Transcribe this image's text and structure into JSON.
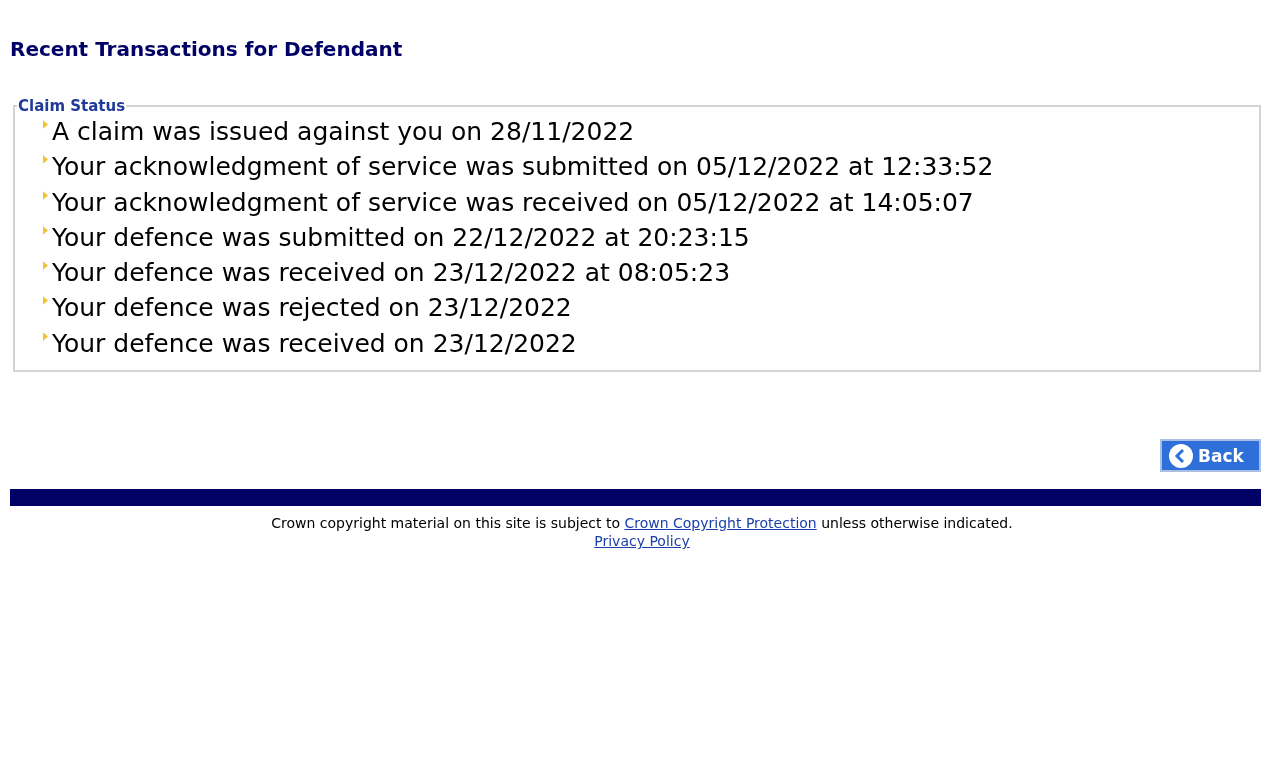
{
  "page_title": "Recent Transactions for Defendant",
  "claim_status": {
    "legend": "Claim Status",
    "items": [
      "A claim was issued against you on 28/11/2022",
      "Your acknowledgment of service was submitted on 05/12/2022 at 12:33:52",
      "Your acknowledgment of service was received on 05/12/2022 at 14:05:07",
      "Your defence was submitted on 22/12/2022 at 20:23:15",
      "Your defence was received on 23/12/2022 at 08:05:23",
      "Your defence was rejected on 23/12/2022",
      "Your defence was received on 23/12/2022"
    ]
  },
  "back_button": "Back",
  "footer": {
    "text_before": "Crown copyright material on this site is subject to ",
    "link": "Crown Copyright Protection",
    "text_after": " unless otherwise indicated.",
    "privacy_link": "Privacy Policy"
  }
}
